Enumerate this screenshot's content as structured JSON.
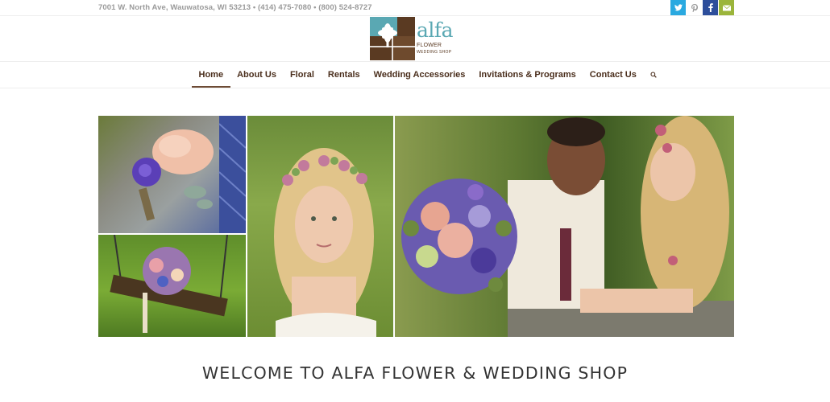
{
  "topbar": {
    "address": "7001 W. North Ave, Wauwatosa, WI 53213 • (414) 475-7080 • (800) 524-8727",
    "social": [
      {
        "icon": "twitter-icon",
        "glyph": "t",
        "color": "#2aa9e0"
      },
      {
        "icon": "pinterest-icon",
        "glyph": "p",
        "color": "#ffffff"
      },
      {
        "icon": "facebook-icon",
        "glyph": "f",
        "color": "#2d4e9b"
      },
      {
        "icon": "mail-icon",
        "glyph": "✉",
        "color": "#9bb53b"
      }
    ]
  },
  "logo": {
    "word": "alfa",
    "line1": "FLOWER",
    "line2": "WEDDING SHOP",
    "brown": "#5a3a22",
    "teal": "#5aa8b3"
  },
  "nav": {
    "items": [
      {
        "label": "Home",
        "active": true
      },
      {
        "label": "About Us"
      },
      {
        "label": "Floral"
      },
      {
        "label": "Rentals"
      },
      {
        "label": "Wedding Accessories"
      },
      {
        "label": "Invitations & Programs"
      },
      {
        "label": "Contact Us"
      }
    ],
    "search_icon": "search-icon"
  },
  "main": {
    "title": "WELCOME TO ALFA FLOWER & WEDDING SHOP"
  }
}
